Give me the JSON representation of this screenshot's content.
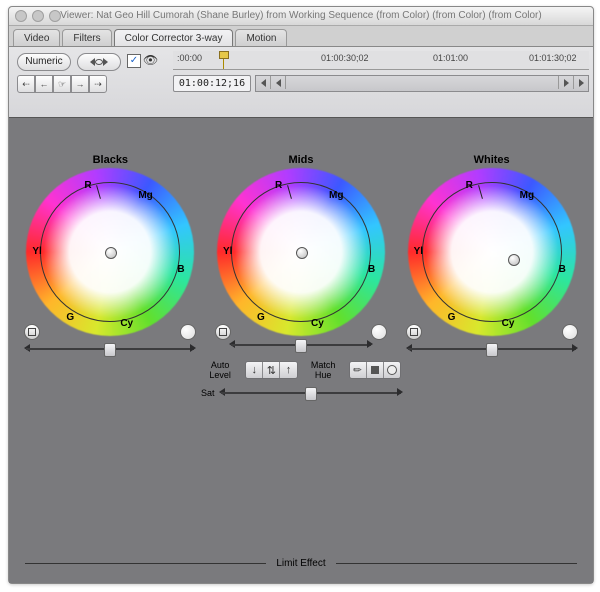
{
  "window": {
    "title": "Viewer: Nat Geo Hill Cumorah (Shane Burley) from Working Sequence (from Color) (from Color) (from Color)"
  },
  "tabs": [
    {
      "label": "Video",
      "active": false
    },
    {
      "label": "Filters",
      "active": false
    },
    {
      "label": "Color Corrector 3-way",
      "active": true
    },
    {
      "label": "Motion",
      "active": false
    }
  ],
  "toolbar": {
    "numeric_label": "Numeric",
    "enabled_checked": "✓",
    "timecode": "01:00:12;16",
    "ruler": [
      {
        "pos": 4,
        "text": ":00:00"
      },
      {
        "pos": 148,
        "text": "01:00:30;02"
      },
      {
        "pos": 260,
        "text": "01:01:00"
      },
      {
        "pos": 356,
        "text": "01:01:30;02"
      }
    ]
  },
  "wheels": [
    {
      "label": "Blacks"
    },
    {
      "label": "Mids"
    },
    {
      "label": "Whites"
    }
  ],
  "wheel_axis": {
    "R": "R",
    "Mg": "Mg",
    "Yl": "Yl",
    "B": "B",
    "G": "G",
    "Cy": "Cy"
  },
  "center": {
    "auto_level": "Auto Level",
    "match_hue": "Match Hue",
    "sat_label": "Sat"
  },
  "limit_label": "Limit Effect"
}
